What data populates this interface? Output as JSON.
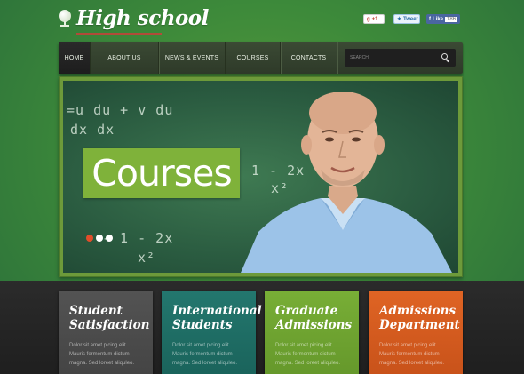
{
  "header": {
    "logo_text": "High school",
    "social": {
      "gplus": "+1",
      "tweet": "Tweet",
      "fb_like": "Like",
      "fb_count": "186"
    }
  },
  "nav": {
    "items": [
      {
        "label": "HOME",
        "active": true
      },
      {
        "label": "ABOUT US",
        "active": false
      },
      {
        "label": "NEWS & EVENTS",
        "active": false
      },
      {
        "label": "COURSES",
        "active": false
      },
      {
        "label": "CONTACTS",
        "active": false
      }
    ],
    "search_placeholder": "SEARCH"
  },
  "slider": {
    "caption": "Courses",
    "chalk_lines": [
      "=u du + v du",
      "  dx        dx",
      "1 - 2x",
      "  x²",
      "- 1 - 2x",
      "   x²"
    ],
    "dots": [
      true,
      false,
      false
    ]
  },
  "cards": [
    {
      "title_line1": "Student",
      "title_line2": "Satisfaction",
      "text": "Dolor sit amet picing elit. Mauris fermentum dictum magna. Sed loreet aliquleo.",
      "color": "#4a4a4a"
    },
    {
      "title_line1": "International",
      "title_line2": "Students",
      "text": "Dolor sit amet picing elit. Mauris fermentum dictum magna. Sed loreet aliquleo.",
      "color": "#1e6e66"
    },
    {
      "title_line1": "Graduate",
      "title_line2": "Admissions",
      "text": "Dolor sit amet picing elit. Mauris fermentum dictum magna. Sed loreet aliquleo.",
      "color": "#6ea232"
    },
    {
      "title_line1": "Admissions",
      "title_line2": "Department",
      "text": "Dolor sit amet picing elit. Mauris fermentum dictum magna. Sed loreet aliquleo.",
      "color": "#d45a1e"
    }
  ]
}
